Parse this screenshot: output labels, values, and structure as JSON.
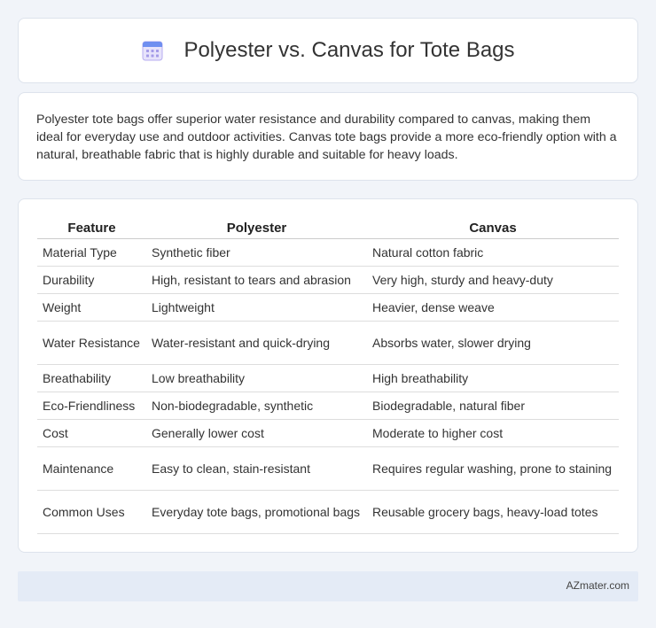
{
  "header": {
    "title": "Polyester vs. Canvas for Tote Bags",
    "icon": "calendar-icon"
  },
  "intro": {
    "text": "Polyester tote bags offer superior water resistance and durability compared to canvas, making them ideal for everyday use and outdoor activities. Canvas tote bags provide a more eco-friendly option with a natural, breathable fabric that is highly durable and suitable for heavy loads."
  },
  "table": {
    "headers": [
      "Feature",
      "Polyester",
      "Canvas"
    ],
    "rows": [
      [
        "Material Type",
        "Synthetic fiber",
        "Natural cotton fabric"
      ],
      [
        "Durability",
        "High, resistant to tears and abrasion",
        "Very high, sturdy and heavy-duty"
      ],
      [
        "Weight",
        "Lightweight",
        "Heavier, dense weave"
      ],
      [
        "Water Resistance",
        "Water-resistant and quick-drying",
        "Absorbs water, slower drying"
      ],
      [
        "Breathability",
        "Low breathability",
        "High breathability"
      ],
      [
        "Eco-Friendliness",
        "Non-biodegradable, synthetic",
        "Biodegradable, natural fiber"
      ],
      [
        "Cost",
        "Generally lower cost",
        "Moderate to higher cost"
      ],
      [
        "Maintenance",
        "Easy to clean, stain-resistant",
        "Requires regular washing, prone to staining"
      ],
      [
        "Common Uses",
        "Everyday tote bags, promotional bags",
        "Reusable grocery bags, heavy-load totes"
      ]
    ]
  },
  "footer": {
    "text": "AZmater.com"
  },
  "colors": {
    "background": "#f1f4f9",
    "footer_bg": "#e4ebf6",
    "icon_accent": "#8a7fe0"
  }
}
